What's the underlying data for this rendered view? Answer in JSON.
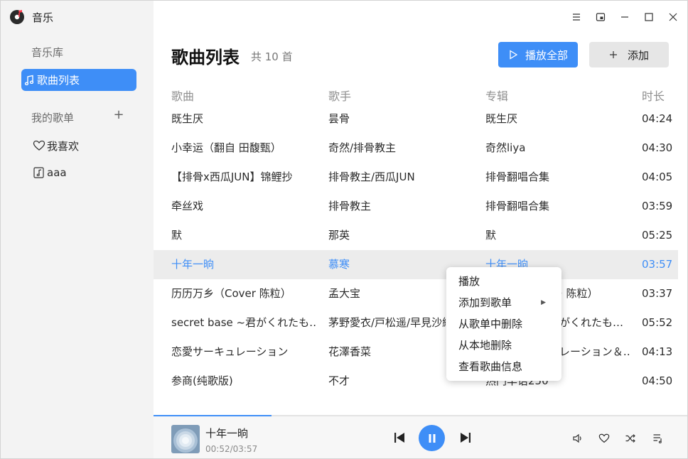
{
  "app": {
    "name": "音乐"
  },
  "sidebar": {
    "library": "音乐库",
    "song_list": "歌曲列表",
    "my_playlists": "我的歌单",
    "add_playlist": "+",
    "playlists": [
      "我喜欢",
      "aaa"
    ]
  },
  "header": {
    "title": "歌曲列表",
    "count": "共 10 首",
    "play_all": "播放全部",
    "add": "添加"
  },
  "table": {
    "columns": [
      "歌曲",
      "歌手",
      "专辑",
      "时长"
    ],
    "rows": [
      {
        "song": "既生厌",
        "artist": "昙骨",
        "album": "既生厌",
        "duration": "04:24"
      },
      {
        "song": "小幸运（翻自 田馥甄）",
        "artist": "奇然/排骨教主",
        "album": "奇然liya",
        "duration": "04:30"
      },
      {
        "song": "【排骨x西瓜JUN】锦鲤抄",
        "artist": "排骨教主/西瓜JUN",
        "album": "排骨翻唱合集",
        "duration": "04:05"
      },
      {
        "song": "牵丝戏",
        "artist": "排骨教主",
        "album": "排骨翻唱合集",
        "duration": "03:59"
      },
      {
        "song": "默",
        "artist": "那英",
        "album": "默",
        "duration": "05:25"
      },
      {
        "song": "十年一晌",
        "artist": "慕寒",
        "album": "十年一晌",
        "duration": "03:57"
      },
      {
        "song": "历历万乡（Cover 陈粒）",
        "artist": "孟大宝",
        "album": "· 陈粒）",
        "duration": "03:37"
      },
      {
        "song": "secret base ~君がくれたも…",
        "artist": "茅野愛衣/戸松遥/早見沙織",
        "album": "がくれたも…",
        "duration": "05:52"
      },
      {
        "song": "恋愛サーキュレーション",
        "artist": "花澤香菜",
        "album": "レーション＆…",
        "duration": "04:13"
      },
      {
        "song": "参商(纯歌版)",
        "artist": "不才",
        "album": "热门华语250",
        "duration": "04:50"
      }
    ],
    "playing_index": 5
  },
  "context_menu": {
    "items": [
      "播放",
      "添加到歌单",
      "从歌单中删除",
      "从本地删除",
      "查看歌曲信息"
    ]
  },
  "player": {
    "title": "十年一晌",
    "time": "00:52/03:57",
    "progress": 0.22
  },
  "colors": {
    "accent": "#3e8ef7",
    "sidebar_bg": "#f3f3f3"
  }
}
